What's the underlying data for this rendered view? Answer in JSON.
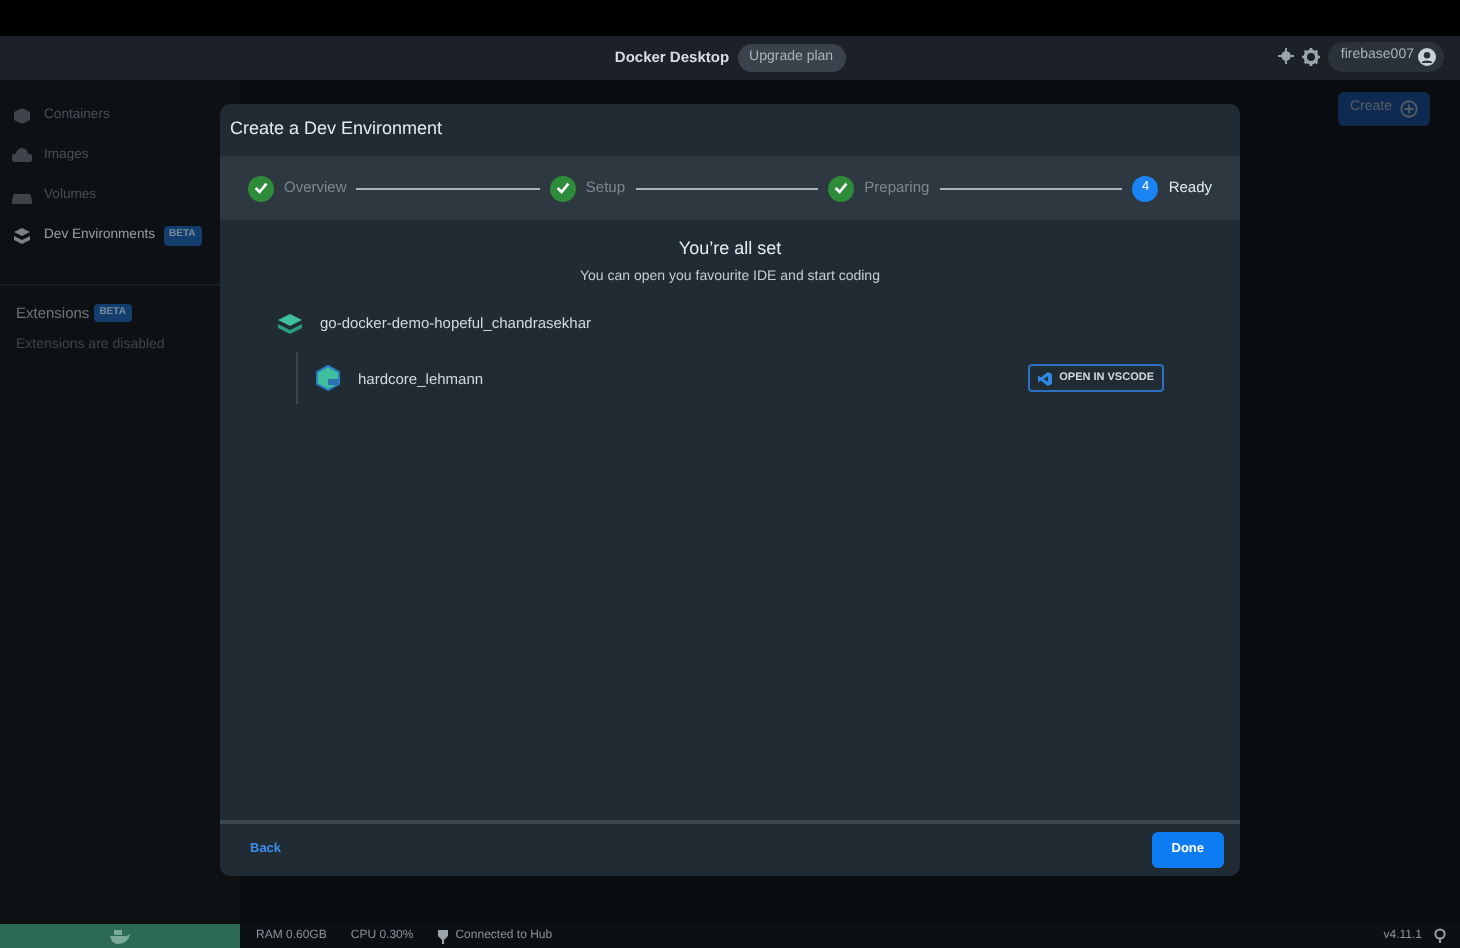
{
  "titlebar": {
    "title": "Docker Desktop",
    "upgrade": "Upgrade plan",
    "user": "firebase007"
  },
  "sidebar": {
    "items": [
      {
        "label": "Containers",
        "selected": false
      },
      {
        "label": "Images",
        "selected": false
      },
      {
        "label": "Volumes",
        "selected": false
      },
      {
        "label": "Dev Environments",
        "selected": true,
        "badge": "BETA"
      }
    ],
    "extensions": {
      "label": "Extensions",
      "badge": "BETA",
      "note": "Extensions are disabled"
    }
  },
  "create_button": "Create",
  "modal": {
    "title": "Create a Dev Environment",
    "steps": [
      {
        "label": "Overview",
        "completed": true,
        "selected": false
      },
      {
        "label": "Setup",
        "completed": true,
        "selected": false
      },
      {
        "label": "Preparing",
        "completed": true,
        "selected": false
      },
      {
        "label": "Ready",
        "number": "4",
        "completed": false,
        "selected": true
      }
    ],
    "heading": "You’re all set",
    "subheading": "You can open you favourite IDE and start coding",
    "environment": {
      "name": "go-docker-demo-hopeful_chandrasekhar",
      "containers": [
        {
          "name": "hardcore_lehmann",
          "action": "OPEN IN VSCODE"
        }
      ]
    },
    "back": "Back",
    "done": "Done"
  },
  "status_bar": {
    "ram": "RAM 0.60GB",
    "cpu": "CPU 0.30%",
    "hub": "Connected to Hub",
    "version": "v4.11.1"
  }
}
